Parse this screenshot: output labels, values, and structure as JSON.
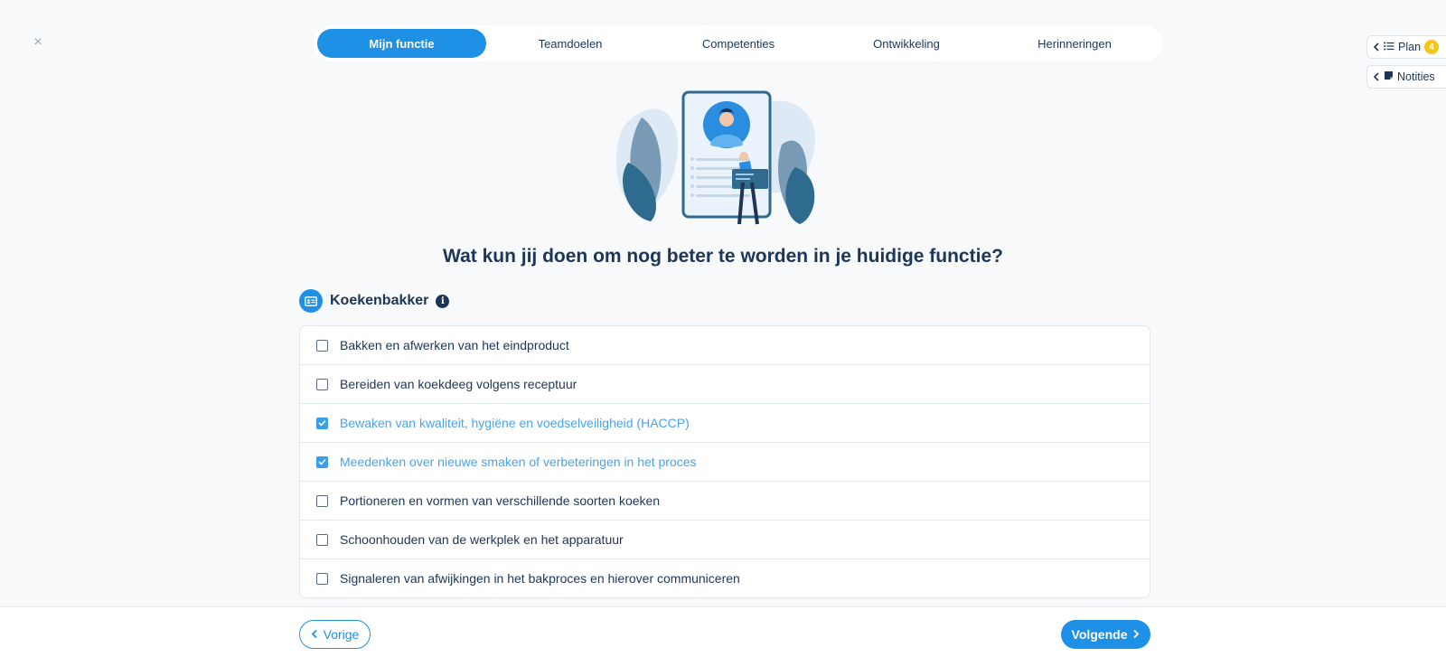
{
  "close": {
    "glyph": "×"
  },
  "tabs": [
    {
      "label": "Mijn functie",
      "active": true
    },
    {
      "label": "Teamdoelen",
      "active": false
    },
    {
      "label": "Competenties",
      "active": false
    },
    {
      "label": "Ontwikkeling",
      "active": false
    },
    {
      "label": "Herinneringen",
      "active": false
    }
  ],
  "side": {
    "plan_label": "Plan",
    "plan_badge": "4",
    "notes_label": "Notities"
  },
  "question": "Wat kun jij doen om nog beter te worden in je huidige functie?",
  "job": {
    "title": "Koekenbakker",
    "info_glyph": "i"
  },
  "tasks": [
    {
      "label": "Bakken en afwerken van het eindproduct",
      "checked": false
    },
    {
      "label": "Bereiden van koekdeeg volgens receptuur",
      "checked": false
    },
    {
      "label": "Bewaken van kwaliteit, hygiëne en voedselveiligheid (HACCP)",
      "checked": true
    },
    {
      "label": "Meedenken over nieuwe smaken of verbeteringen in het proces",
      "checked": true
    },
    {
      "label": "Portioneren en vormen van verschillende soorten koeken",
      "checked": false
    },
    {
      "label": "Schoonhouden van de werkplek en het apparatuur",
      "checked": false
    },
    {
      "label": "Signaleren van afwijkingen in het bakproces en hierover communiceren",
      "checked": false
    }
  ],
  "footer": {
    "prev_label": "Vorige",
    "next_label": "Volgende"
  },
  "colors": {
    "accent": "#1e90e6",
    "text": "#1d3557",
    "checked_text": "#4aa3e8",
    "badge": "#f5c518"
  }
}
